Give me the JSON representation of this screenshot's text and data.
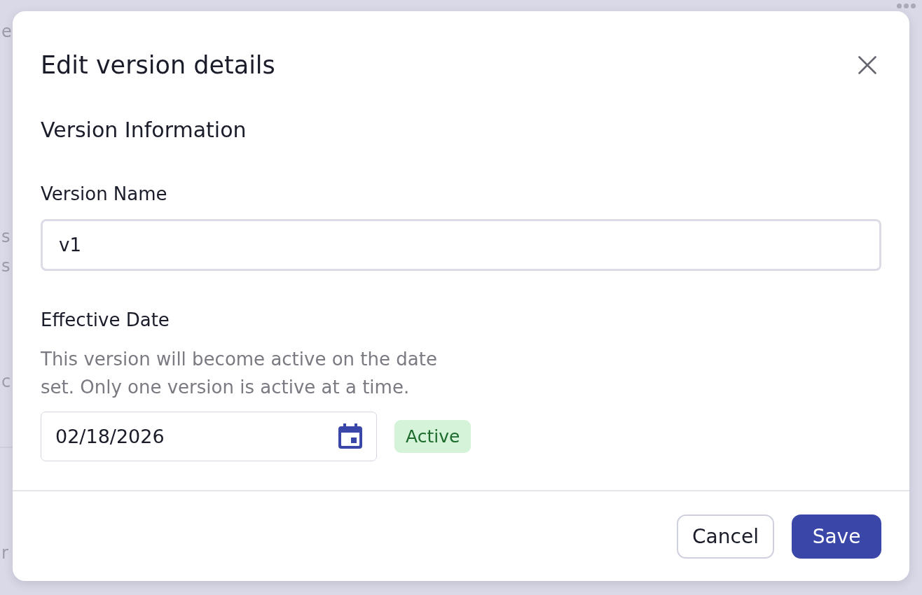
{
  "background": {
    "text_fragments": [
      "e",
      "s",
      "s",
      "c",
      "r"
    ]
  },
  "dialog": {
    "title": "Edit version details",
    "section_title": "Version Information",
    "fields": [
      {
        "kind": "text",
        "label": "Version Name",
        "value": "v1"
      },
      {
        "kind": "date",
        "label": "Effective Date",
        "help": "This version will become active on the date set. Only one version is active at a time.",
        "value": "02/18/2026",
        "badge": "Active"
      }
    ],
    "buttons": [
      {
        "kind": "secondary",
        "label": "Cancel"
      },
      {
        "kind": "primary",
        "label": "Save"
      }
    ]
  }
}
